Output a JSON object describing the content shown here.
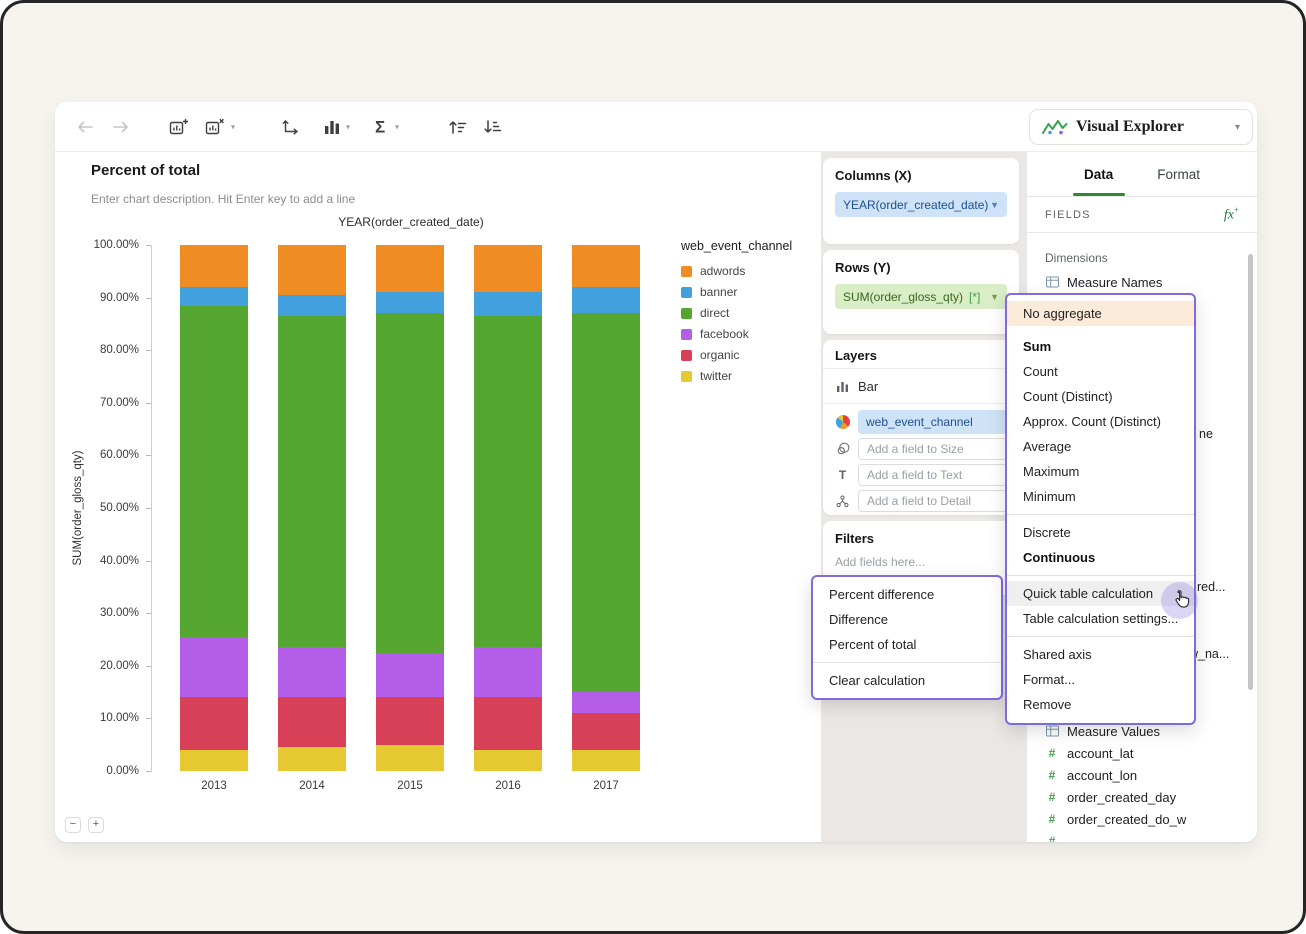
{
  "toolbar": {
    "brand_label": "Visual Explorer",
    "icons": [
      "back-arrow",
      "forward-arrow",
      "duplicate-chart",
      "remove-chart",
      "swap-axes",
      "chart-type",
      "aggregate-sigma",
      "sort-ascending",
      "sort-descending"
    ]
  },
  "chart_header": {
    "title": "Percent of total",
    "description_placeholder": "Enter chart description. Hit Enter key to add a line"
  },
  "zoom_controls": {
    "zoom_out": "−",
    "zoom_in": "+"
  },
  "chart_data": {
    "type": "bar",
    "stacked": true,
    "percent_of_total": true,
    "title": "YEAR(order_created_date)",
    "ylabel": "SUM(order_gloss_qty)",
    "categories": [
      "2013",
      "2014",
      "2015",
      "2016",
      "2017"
    ],
    "series": [
      {
        "name": "adwords",
        "color": "#ef8c23",
        "values": [
          8,
          9.5,
          9,
          9,
          8
        ]
      },
      {
        "name": "banner",
        "color": "#42a0dc",
        "values": [
          3.5,
          4,
          4,
          4.5,
          5
        ]
      },
      {
        "name": "direct",
        "color": "#55a630",
        "values": [
          63,
          63,
          64.5,
          63,
          72
        ]
      },
      {
        "name": "facebook",
        "color": "#b35de8",
        "values": [
          11.5,
          9.5,
          8.5,
          9.5,
          4
        ]
      },
      {
        "name": "organic",
        "color": "#d84058",
        "values": [
          10,
          9.5,
          9,
          10,
          7
        ]
      },
      {
        "name": "twitter",
        "color": "#e5c832",
        "values": [
          4,
          4.5,
          5,
          4,
          4
        ]
      }
    ],
    "y_ticks": [
      "100.00%",
      "90.00%",
      "80.00%",
      "70.00%",
      "60.00%",
      "50.00%",
      "40.00%",
      "30.00%",
      "20.00%",
      "10.00%",
      "0.00%"
    ],
    "ylim": [
      0,
      100
    ],
    "legend_title": "web_event_channel",
    "legend_position": "right",
    "grid": false
  },
  "shelves": {
    "columns": {
      "header": "Columns (X)",
      "pill": "YEAR(order_created_date)"
    },
    "rows": {
      "header": "Rows (Y)",
      "pill": "SUM(order_gloss_qty)",
      "pill_suffix": "[*]"
    },
    "layers": {
      "header": "Layers",
      "type_label": "Bar",
      "color_pill": "web_event_channel",
      "slots": [
        {
          "icon": "size-icon",
          "placeholder": "Add a field to Size"
        },
        {
          "icon": "text-icon",
          "placeholder": "Add a field to Text"
        },
        {
          "icon": "detail-icon",
          "placeholder": "Add a field to Detail"
        }
      ]
    },
    "filters": {
      "header": "Filters",
      "placeholder": "Add fields here..."
    }
  },
  "fields_panel": {
    "tabs": [
      {
        "label": "Data",
        "active": true
      },
      {
        "label": "Format",
        "active": false
      }
    ],
    "fields_label": "FIELDS",
    "dimensions_label": "Dimensions",
    "dimension_items": [
      {
        "label": "Measure Names",
        "icon": "measure-icon"
      }
    ],
    "occluded_fragments": [
      "ne",
      "red...",
      "w_na..."
    ],
    "measure_items": [
      {
        "label": "Measure Values",
        "icon": "measure-icon"
      },
      {
        "label": "account_lat",
        "icon": "number-icon"
      },
      {
        "label": "account_lon",
        "icon": "number-icon"
      },
      {
        "label": "order_created_day",
        "icon": "number-icon"
      },
      {
        "label": "order_created_do_w",
        "icon": "number-icon"
      }
    ]
  },
  "aggregate_menu": {
    "items": [
      {
        "label": "No aggregate",
        "highlight": "peach",
        "gap_after": true
      },
      {
        "label": "Sum",
        "bold": true
      },
      {
        "label": "Count"
      },
      {
        "label": "Count (Distinct)"
      },
      {
        "label": "Approx. Count (Distinct)"
      },
      {
        "label": "Average"
      },
      {
        "label": "Maximum"
      },
      {
        "label": "Minimum"
      },
      {
        "divider": true
      },
      {
        "label": "Discrete"
      },
      {
        "label": "Continuous",
        "bold": true
      },
      {
        "divider": true
      },
      {
        "label": "Quick table calculation",
        "highlight": "hover"
      },
      {
        "label": "Table calculation settings..."
      },
      {
        "divider": true
      },
      {
        "label": "Shared axis"
      },
      {
        "label": "Format..."
      },
      {
        "label": "Remove"
      }
    ]
  },
  "table_calc_menu": {
    "items": [
      {
        "label": "Percent difference"
      },
      {
        "label": "Difference"
      },
      {
        "label": "Percent of total"
      },
      {
        "divider": true
      },
      {
        "label": "Clear calculation"
      }
    ]
  },
  "colors": {
    "accent_purple": "#7f6ae0",
    "tab_active_green": "#2f8a2f",
    "pill_blue_bg": "#cfe3f8",
    "pill_green_bg": "#d9edc6",
    "menu_highlight_peach": "#fcebd9",
    "menu_hover_gray": "#efefef",
    "shelf_background": "#eae7e4"
  }
}
